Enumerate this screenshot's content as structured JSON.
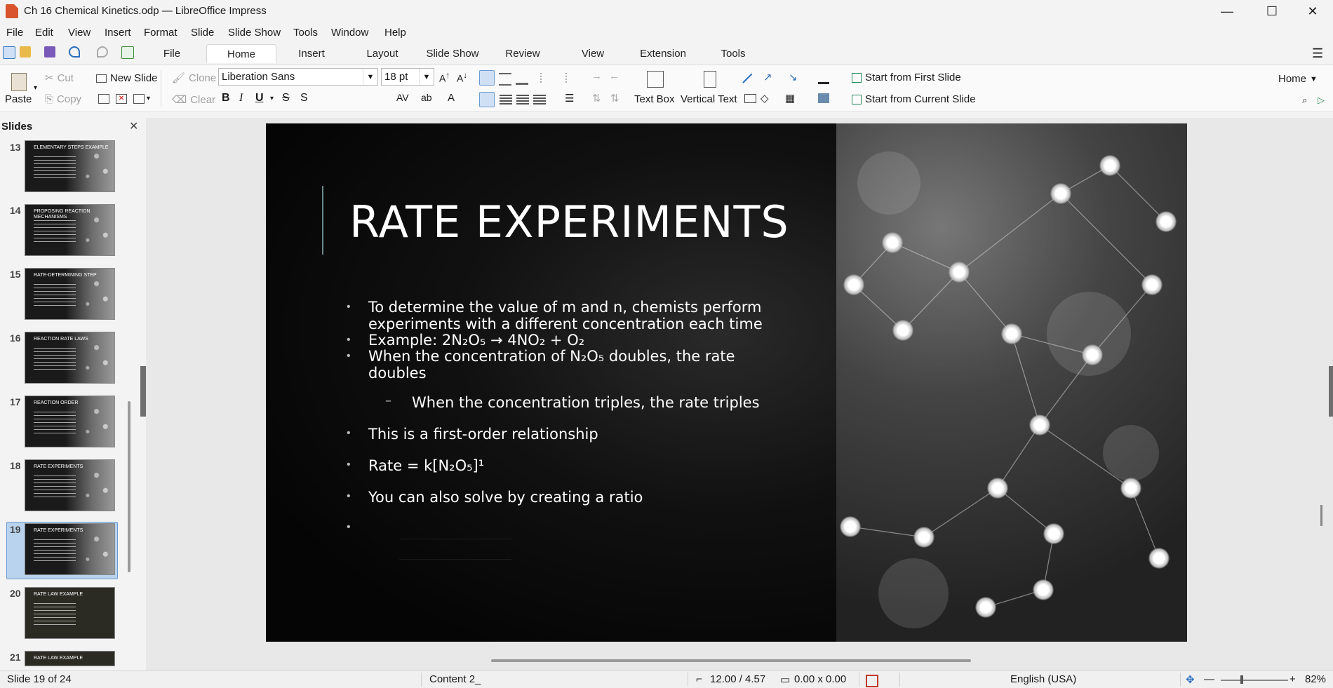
{
  "window": {
    "title": "Ch 16 Chemical Kinetics.odp — LibreOffice Impress",
    "minimize": "—",
    "maximize": "☐",
    "close": "✕"
  },
  "menu": [
    "File",
    "Edit",
    "View",
    "Insert",
    "Format",
    "Slide",
    "Slide Show",
    "Tools",
    "Window",
    "Help"
  ],
  "tabs": [
    "File",
    "Home",
    "Insert",
    "Layout",
    "Slide Show",
    "Review",
    "View",
    "Extension",
    "Tools"
  ],
  "active_tab": "Home",
  "ribbon": {
    "paste": "Paste",
    "cut": "Cut",
    "copy": "Copy",
    "new_slide": "New Slide",
    "clone": "Clone",
    "clear": "Clear",
    "font_name": "Liberation Sans",
    "font_size": "18 pt",
    "text_box": "Text Box",
    "vertical_text": "Vertical Text",
    "start_first": "Start from First Slide",
    "start_current": "Start from Current Slide",
    "home_dropdown": "Home"
  },
  "slides_panel": {
    "title": "Slides",
    "thumbnails": [
      {
        "num": "13",
        "title": "ELEMENTARY STEPS EXAMPLE"
      },
      {
        "num": "14",
        "title": "PROPOSING REACTION MECHANISMS"
      },
      {
        "num": "15",
        "title": "RATE-DETERMINING STEP"
      },
      {
        "num": "16",
        "title": "REACTION RATE LAWS"
      },
      {
        "num": "17",
        "title": "REACTION ORDER"
      },
      {
        "num": "18",
        "title": "RATE EXPERIMENTS"
      },
      {
        "num": "19",
        "title": "RATE EXPERIMENTS"
      },
      {
        "num": "20",
        "title": "RATE LAW EXAMPLE"
      },
      {
        "num": "21",
        "title": "RATE LAW EXAMPLE"
      }
    ],
    "selected": "19"
  },
  "slide": {
    "title": "RATE EXPERIMENTS",
    "b1_l1": "To determine the value of m and n, chemists perform",
    "b1_l2": "experiments with a different concentration each time",
    "b2": "Example: 2N₂O₅ → 4NO₂ + O₂",
    "b3_l1": "When the concentration of N₂O₅ doubles, the rate",
    "b3_l2": "doubles",
    "sub1": "When the concentration triples, the rate triples",
    "b4": "This is a first-order relationship",
    "b5": "Rate = k[N₂O₅]¹",
    "b6": "You can also solve by creating a ratio",
    "sub_dash": "–",
    "bullet_char": "•"
  },
  "status": {
    "slide_count": "Slide 19 of 24",
    "layout": "Content 2_",
    "position": "12.00 / 4.57",
    "size": "0.00 x 0.00",
    "language": "English (USA)",
    "zoom": "82%"
  }
}
